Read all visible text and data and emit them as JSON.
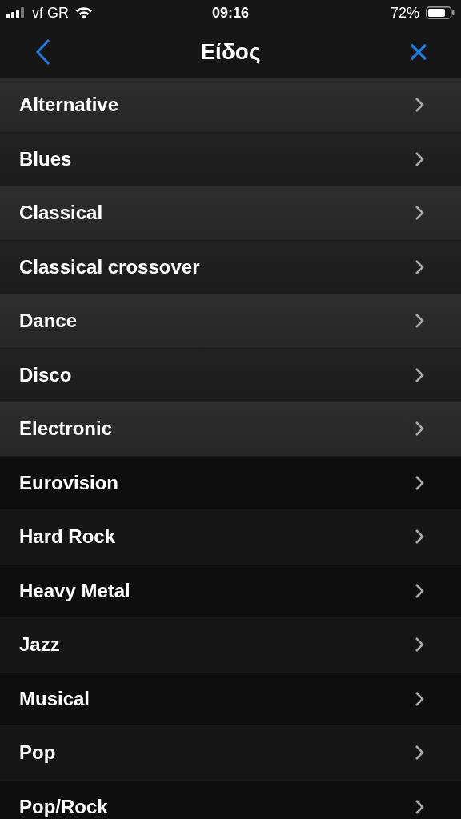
{
  "status_bar": {
    "carrier": "vf GR",
    "time": "09:16",
    "battery": "72%"
  },
  "nav": {
    "title": "Είδος"
  },
  "genres": [
    {
      "label": "Alternative"
    },
    {
      "label": "Blues"
    },
    {
      "label": "Classical"
    },
    {
      "label": "Classical crossover"
    },
    {
      "label": "Dance"
    },
    {
      "label": "Disco"
    },
    {
      "label": "Electronic"
    },
    {
      "label": "Eurovision"
    },
    {
      "label": "Hard Rock"
    },
    {
      "label": "Heavy Metal"
    },
    {
      "label": "Jazz"
    },
    {
      "label": "Musical"
    },
    {
      "label": "Pop"
    },
    {
      "label": "Pop/Rock"
    }
  ]
}
